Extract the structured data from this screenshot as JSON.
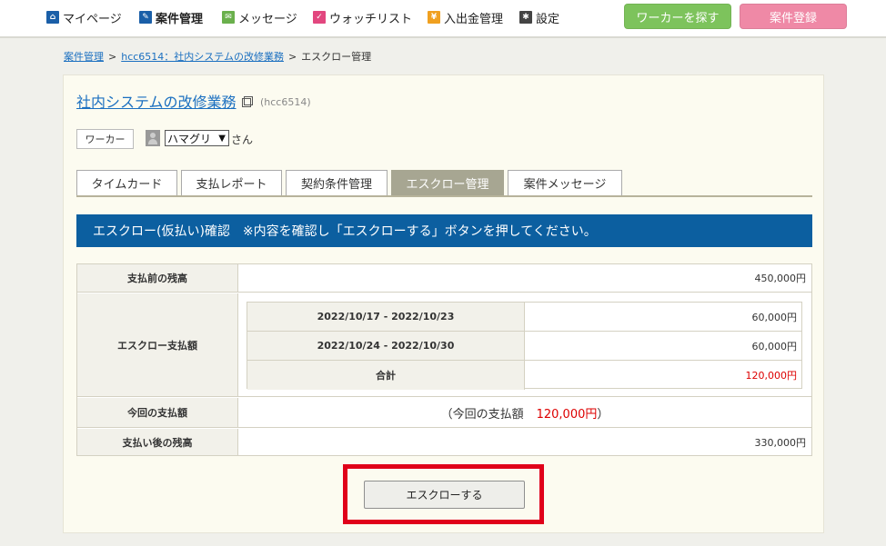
{
  "nav": {
    "items": [
      {
        "label": "マイページ",
        "icon": "home-icon"
      },
      {
        "label": "案件管理",
        "icon": "pencil-icon"
      },
      {
        "label": "メッセージ",
        "icon": "mail-icon"
      },
      {
        "label": "ウォッチリスト",
        "icon": "check-icon"
      },
      {
        "label": "入出金管理",
        "icon": "yen-icon"
      },
      {
        "label": "設定",
        "icon": "gear-icon"
      }
    ],
    "find_worker": "ワーカーを探す",
    "register_job": "案件登録"
  },
  "breadcrumb": {
    "root": "案件管理",
    "job": "hcc6514：社内システムの改修業務",
    "current": "エスクロー管理"
  },
  "job": {
    "title": "社内システムの改修業務",
    "code": "(hcc6514)"
  },
  "worker": {
    "label": "ワーカー",
    "name": "ハマグリ",
    "suffix": "さん"
  },
  "tabs": [
    "タイムカード",
    "支払レポート",
    "契約条件管理",
    "エスクロー管理",
    "案件メッセージ"
  ],
  "banner": "エスクロー(仮払い)確認　※内容を確認し「エスクローする」ボタンを押してください。",
  "table": {
    "balance_before_label": "支払前の残高",
    "balance_before": "450,000円",
    "escrow_label": "エスクロー支払額",
    "periods": [
      {
        "period": "2022/10/17 - 2022/10/23",
        "amount": "60,000円"
      },
      {
        "period": "2022/10/24 - 2022/10/30",
        "amount": "60,000円"
      }
    ],
    "total_label": "合計",
    "total": "120,000円",
    "this_payment_label": "今回の支払額",
    "this_payment_text": "（今回の支払額",
    "this_payment_amount": "120,000円",
    "this_payment_close": "）",
    "balance_after_label": "支払い後の残高",
    "balance_after": "330,000円"
  },
  "escrow_button": "エスクローする",
  "colors": {
    "accent_blue": "#0c5fa0",
    "link": "#1a6fc0",
    "green_button": "#7dc35c",
    "pink_button": "#ef89a6",
    "highlight_red": "#e0001a"
  }
}
